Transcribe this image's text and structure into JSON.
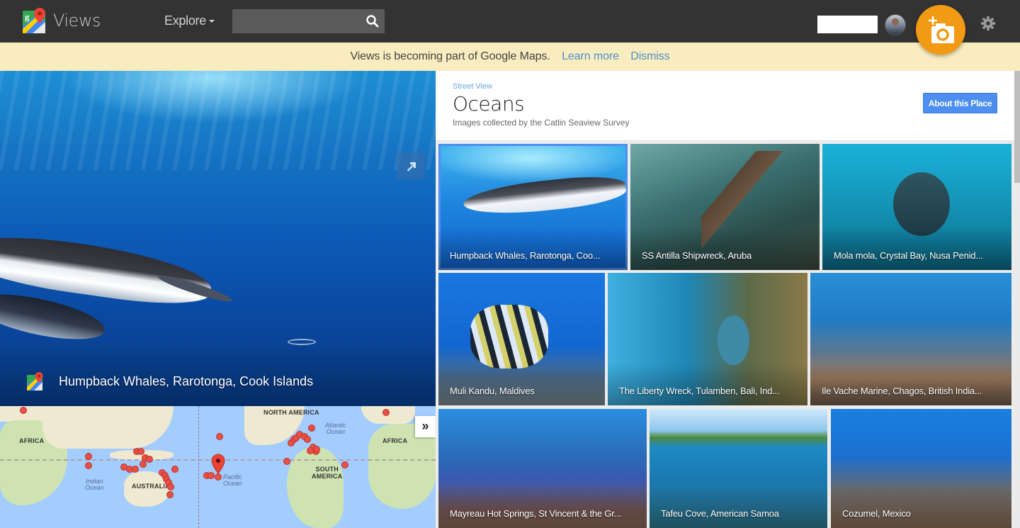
{
  "topbar": {
    "brand": "Views",
    "explore_label": "Explore",
    "search": {
      "value": "",
      "placeholder": ""
    },
    "icons": {
      "logo": "google-maps-logo",
      "search": "search-icon",
      "avatar": "user-avatar",
      "add_photo": "add-photo-camera-icon",
      "settings": "gear-icon"
    },
    "accent_color": "#f29a13"
  },
  "banner": {
    "message": "Views is becoming part of Google Maps.",
    "learn_more": "Learn more",
    "dismiss": "Dismiss"
  },
  "hero": {
    "caption": "Humpback Whales, Rarotonga, Cook Islands",
    "expand_icon": "expand-arrow-icon"
  },
  "map": {
    "labels": {
      "africa_left": "AFRICA",
      "africa_right": "AFRICA",
      "north_america": "NORTH AMERICA",
      "south_america_1": "SOUTH",
      "south_america_2": "AMERICA",
      "australia": "AUSTRALIA",
      "indian_ocean_1": "Indian",
      "indian_ocean_2": "Ocean",
      "pacific_ocean_1": "Pacific",
      "pacific_ocean_2": "Ocean",
      "atlantic_ocean_1": "Atlantic",
      "atlantic_ocean_2": "Ocean"
    },
    "collapse_label": "»"
  },
  "collection": {
    "breadcrumb": "Street View",
    "title": "Oceans",
    "subtitle": "Images collected by the Catlin Seaview Survey",
    "about_button": "About this Place",
    "tiles": [
      {
        "label": "Humpback Whales, Rarotonga, Coo...",
        "selected": true
      },
      {
        "label": "SS Antilla Shipwreck, Aruba"
      },
      {
        "label": "Mola mola, Crystal Bay, Nusa Penid..."
      },
      {
        "label": "Muli Kandu, Maldives"
      },
      {
        "label": "The Liberty Wreck, Tulamben, Bali, Ind..."
      },
      {
        "label": "Ile Vache Marine, Chagos, British India..."
      },
      {
        "label": "Mayreau Hot Springs, St Vincent & the Gr..."
      },
      {
        "label": "Tafeu Cove, American Samoa"
      },
      {
        "label": "Cozumel, Mexico"
      }
    ]
  }
}
